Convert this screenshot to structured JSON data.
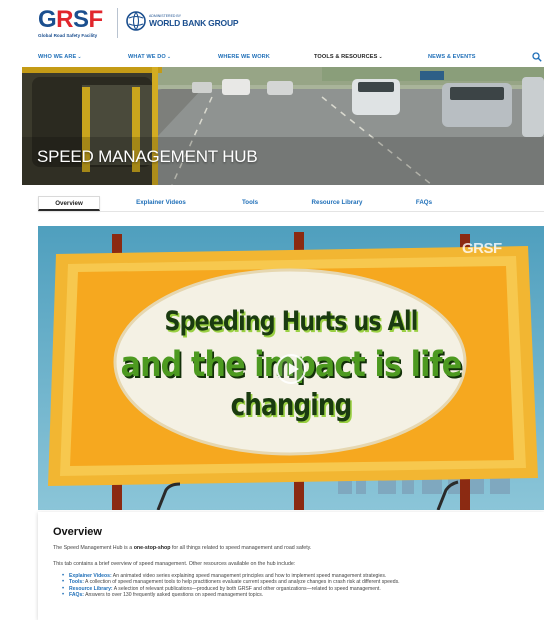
{
  "header": {
    "grsf": {
      "g": "G",
      "r": "R",
      "s": "S",
      "f": "F",
      "subtitle": "Global Road Safety Facility"
    },
    "worldbank": {
      "small": "ADMINISTERED BY",
      "name": "WORLD BANK GROUP"
    }
  },
  "nav": {
    "items": [
      {
        "label": "WHO WE ARE",
        "caret": "⌄"
      },
      {
        "label": "WHAT WE DO",
        "caret": "⌄"
      },
      {
        "label": "WHERE WE WORK"
      },
      {
        "label": "TOOLS & RESOURCES",
        "caret": "⌄"
      },
      {
        "label": "NEWS & EVENTS"
      }
    ]
  },
  "hero": {
    "title": "SPEED MANAGEMENT HUB"
  },
  "tabs": [
    "Overview",
    "Explainer Videos",
    "Tools",
    "Resource Library",
    "FAQs"
  ],
  "video": {
    "watermark": "GRSF",
    "line1": "Speeding Hurts us All",
    "line2": "and the impact is life",
    "line3": "changing"
  },
  "overview": {
    "heading": "Overview",
    "p1_before": "The Speed Management Hub is a ",
    "p1_bold": "one-stop-shop",
    "p1_after": " for all things related to speed management and road safety.",
    "p2": "This tab contains a brief overview of speed management. Other resources available on the hub include:",
    "items": [
      {
        "key": "Explainer Videos:",
        "text": " An animated video series explaining speed management principles and how to implement speed management strategies."
      },
      {
        "key": "Tools:",
        "text": " A collection of speed management tools to help practitioners evaluate current speeds and analyze changes in crash risk at different speeds."
      },
      {
        "key": "Resource Library:",
        "text": " A selection of relevant publications—produced by both GRSF and other organizations—related to speed management."
      },
      {
        "key": "FAQs:",
        "text": " Answers to over 130 frequently asked questions on speed management topics."
      }
    ]
  },
  "colors": {
    "brand_blue": "#1b4f8f",
    "brand_red": "#e1262d",
    "link_blue": "#1f6fb8"
  }
}
